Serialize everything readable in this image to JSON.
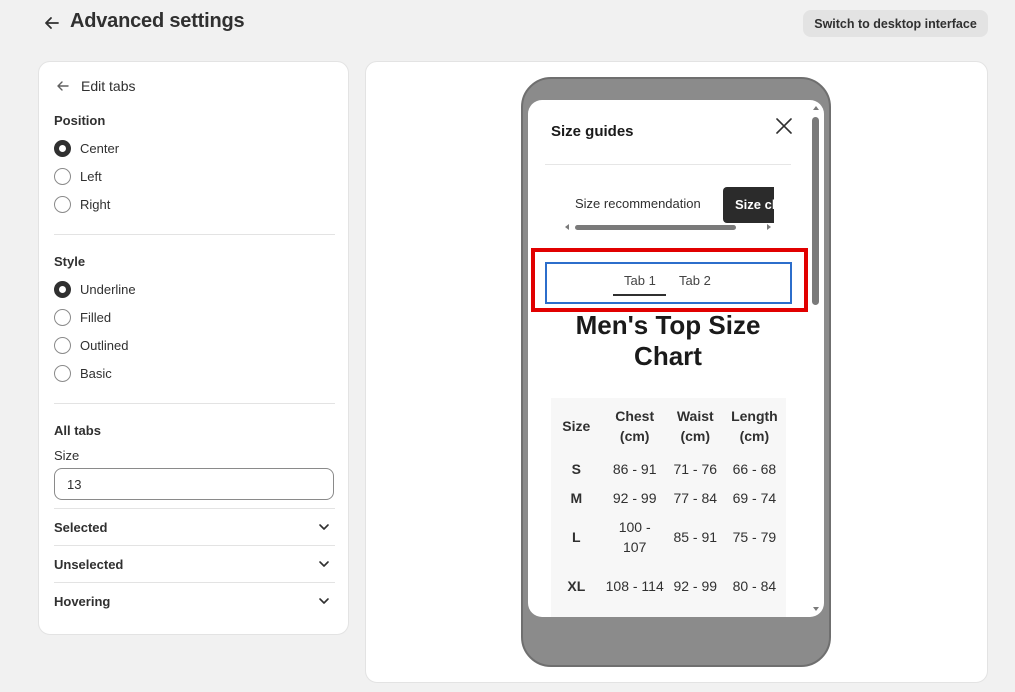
{
  "header": {
    "title": "Advanced settings",
    "switch_label": "Switch to desktop interface"
  },
  "panel": {
    "back_label": "Edit tabs",
    "position": {
      "heading": "Position",
      "options": [
        "Center",
        "Left",
        "Right"
      ],
      "selected": "Center"
    },
    "style": {
      "heading": "Style",
      "options": [
        "Underline",
        "Filled",
        "Outlined",
        "Basic"
      ],
      "selected": "Underline"
    },
    "all_tabs": {
      "heading": "All tabs",
      "size_label": "Size",
      "size_value": "13"
    },
    "collapsibles": [
      "Selected",
      "Unselected",
      "Hovering"
    ]
  },
  "preview": {
    "modal_title": "Size guides",
    "tab_recommendation": "Size recommendation",
    "tab_chart": "Size chart",
    "inner_tabs": [
      "Tab 1",
      "Tab 2"
    ],
    "chart_title": "Men's Top Size Chart",
    "table": {
      "headers": [
        "Size",
        "Chest\n(cm)",
        "Waist\n(cm)",
        "Length\n(cm)"
      ],
      "rows": [
        [
          "S",
          "86 - 91",
          "71 - 76",
          "66 - 68"
        ],
        [
          "M",
          "92 - 99",
          "77 - 84",
          "69 - 74"
        ],
        [
          "L",
          "100 - 107",
          "85 - 91",
          "75 - 79"
        ],
        [
          "XL",
          "108 - 114",
          "92 - 99",
          "80 - 84"
        ]
      ]
    }
  },
  "colors": {
    "highlight": "#e10000",
    "focus": "#2c6ecb",
    "phone_frame": "#8b8b8b"
  }
}
